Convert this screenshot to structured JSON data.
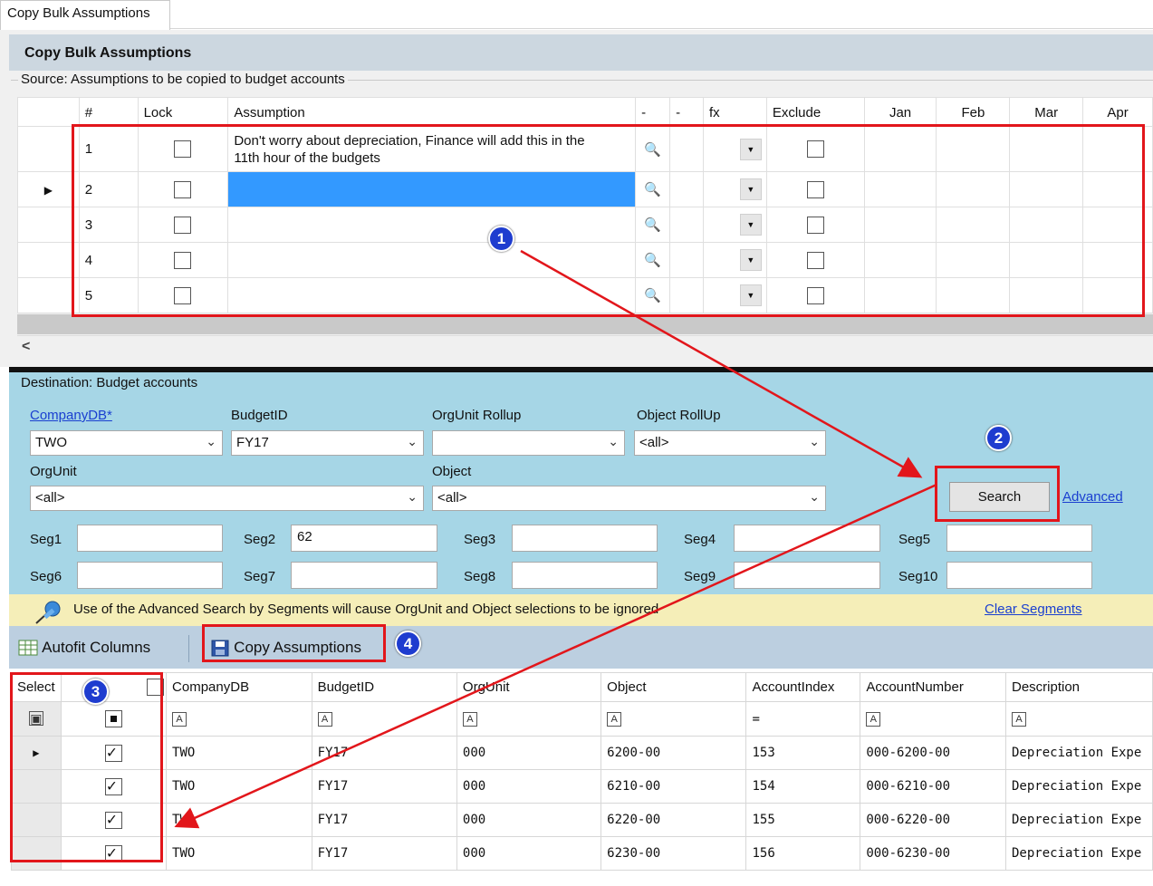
{
  "tab": {
    "label": "Copy Bulk Assumptions"
  },
  "header": {
    "title": "Copy Bulk Assumptions"
  },
  "source": {
    "legend": "Source: Assumptions to be copied to budget accounts",
    "columns": [
      "#",
      "Lock",
      "Assumption",
      "-",
      "-",
      "fx",
      "Exclude",
      "Jan",
      "Feb",
      "Mar",
      "Apr"
    ],
    "rows": [
      {
        "num": "1",
        "assumption_line1": "Don't worry about depreciation, Finance will add this in the",
        "assumption_line2": "11th hour of the budgets"
      },
      {
        "num": "2",
        "assumption_line1": "",
        "assumption_line2": ""
      },
      {
        "num": "3",
        "assumption_line1": "",
        "assumption_line2": ""
      },
      {
        "num": "4",
        "assumption_line1": "",
        "assumption_line2": ""
      },
      {
        "num": "5",
        "assumption_line1": "",
        "assumption_line2": ""
      }
    ],
    "scroll_left": "<"
  },
  "destination": {
    "legend": "Destination: Budget accounts",
    "companydb_label": "CompanyDB*",
    "companydb_value": "TWO",
    "budgetid_label": "BudgetID",
    "budgetid_value": "FY17",
    "orgunit_rollup_label": "OrgUnit Rollup",
    "orgunit_rollup_value": "",
    "object_rollup_label": "Object RollUp",
    "object_rollup_value": "<all>",
    "orgunit_label": "OrgUnit",
    "orgunit_value": "<all>",
    "object_label": "Object",
    "object_value": "<all>",
    "search_button": "Search",
    "advanced_link": "Advanced",
    "segments": [
      {
        "label": "Seg1",
        "value": ""
      },
      {
        "label": "Seg2",
        "value": "62"
      },
      {
        "label": "Seg3",
        "value": ""
      },
      {
        "label": "Seg4",
        "value": ""
      },
      {
        "label": "Seg5",
        "value": ""
      },
      {
        "label": "Seg6",
        "value": ""
      },
      {
        "label": "Seg7",
        "value": ""
      },
      {
        "label": "Seg8",
        "value": ""
      },
      {
        "label": "Seg9",
        "value": ""
      },
      {
        "label": "Seg10",
        "value": ""
      }
    ],
    "warning": "Use of the Advanced Search by Segments will cause OrgUnit and Object selections to be ignored",
    "clear_segments": "Clear Segments"
  },
  "toolbar": {
    "autofit": "Autofit Columns",
    "copy": "Copy Assumptions"
  },
  "results": {
    "columns": [
      "Select",
      "CompanyDB",
      "BudgetID",
      "OrgUnit",
      "Object",
      "AccountIndex",
      "AccountNumber",
      "Description"
    ],
    "filter_eq": "=",
    "rows": [
      {
        "company": "TWO",
        "budget": "FY17",
        "orgunit": "000",
        "object": "6200-00",
        "index": "153",
        "number": "000-6200-00",
        "desc": "Depreciation Expe"
      },
      {
        "company": "TWO",
        "budget": "FY17",
        "orgunit": "000",
        "object": "6210-00",
        "index": "154",
        "number": "000-6210-00",
        "desc": "Depreciation Expe"
      },
      {
        "company": "TWO",
        "budget": "FY17",
        "orgunit": "000",
        "object": "6220-00",
        "index": "155",
        "number": "000-6220-00",
        "desc": "Depreciation Expe"
      },
      {
        "company": "TWO",
        "budget": "FY17",
        "orgunit": "000",
        "object": "6230-00",
        "index": "156",
        "number": "000-6230-00",
        "desc": "Depreciation Expe"
      }
    ]
  },
  "callouts": [
    "1",
    "2",
    "3",
    "4"
  ],
  "colors": {
    "highlight": "#3399ff",
    "annotation": "#e2161b",
    "badge": "#1e3ccf",
    "destination_bg": "#a6d6e6"
  }
}
